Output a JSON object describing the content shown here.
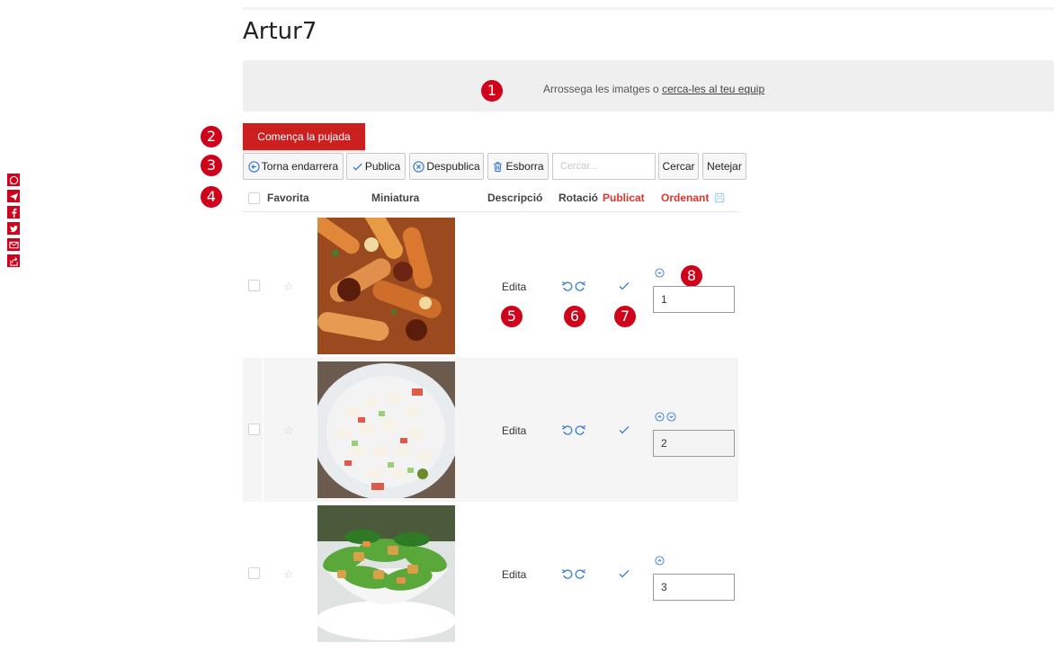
{
  "page": {
    "title": "Artur7"
  },
  "dropzone": {
    "text": "Arrossega les imatges o ",
    "link": "cerca-les al teu equip"
  },
  "upload": {
    "label": "Comença la pujada"
  },
  "toolbar": {
    "back": "Torna endarrera",
    "publish": "Publica",
    "unpublish": "Despublica",
    "delete": "Esborra",
    "search_placeholder": "Cercar...",
    "search": "Cercar",
    "clear": "Netejar"
  },
  "table": {
    "headers": {
      "favorite": "Favorita",
      "thumbnail": "Miniatura",
      "description": "Descripció",
      "rotation": "Rotació",
      "published": "Publicat",
      "ordering": "Ordenant"
    },
    "rows": [
      {
        "edit": "Edita",
        "order": "1",
        "image": "pasta-dish",
        "arrows": [
          "arrow-down"
        ]
      },
      {
        "edit": "Edita",
        "order": "2",
        "image": "bean-salad",
        "arrows": [
          "arrow-up",
          "arrow-down"
        ]
      },
      {
        "edit": "Edita",
        "order": "3",
        "image": "caesar-salad",
        "arrows": [
          "arrow-up"
        ]
      }
    ]
  },
  "badges": [
    "1",
    "2",
    "3",
    "4",
    "5",
    "6",
    "7",
    "8"
  ],
  "colors": {
    "accent": "#cc1f1f",
    "badge": "#d0021b",
    "link_blue": "#3a7bd5",
    "header_red": "#e0342f"
  },
  "social": [
    "whatsapp-icon",
    "telegram-icon",
    "facebook-icon",
    "twitter-icon",
    "email-icon",
    "share-icon"
  ]
}
